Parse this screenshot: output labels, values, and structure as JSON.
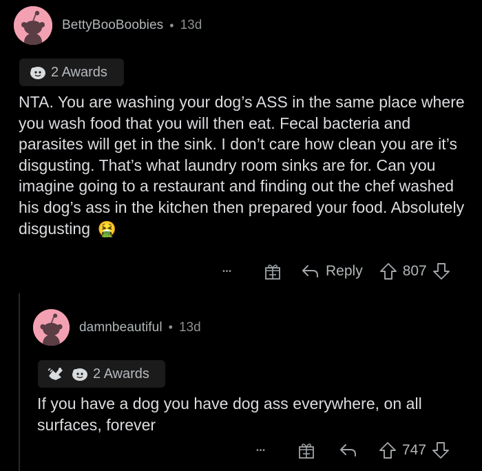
{
  "comments": [
    {
      "username": "BettyBooBoobies",
      "separator": "•",
      "time": "13d",
      "awards_label": "2 Awards",
      "body": "NTA. You are washing your dog’s ASS in the same place where you wash food that you will then eat. Fecal bacteria and parasites will get in the sink. I don’t care how clean you are it’s disgusting. That’s what laundry room sinks are for. Can you imagine going to a restaurant and finding out the chef washed his dog’s ass in the kitchen then prepared your food. Absolutely disgusting",
      "emoji": "🤮",
      "more": "•••",
      "reply_label": "Reply",
      "votes": "807"
    },
    {
      "username": "damnbeautiful",
      "separator": "•",
      "time": "13d",
      "awards_label": "2 Awards",
      "body": "If you have a dog you have dog ass everywhere, on all surfaces, forever",
      "more": "•••",
      "votes": "747"
    }
  ],
  "colors": {
    "background": "#000000",
    "avatar_pink": "#f3a1b2",
    "text": "#dcdde0",
    "muted": "#8d9194"
  },
  "icons": [
    "snoo-avatar-icon",
    "award-icon",
    "gift-icon",
    "reply-arrow-icon",
    "upvote-icon",
    "downvote-icon",
    "more-options-icon"
  ]
}
